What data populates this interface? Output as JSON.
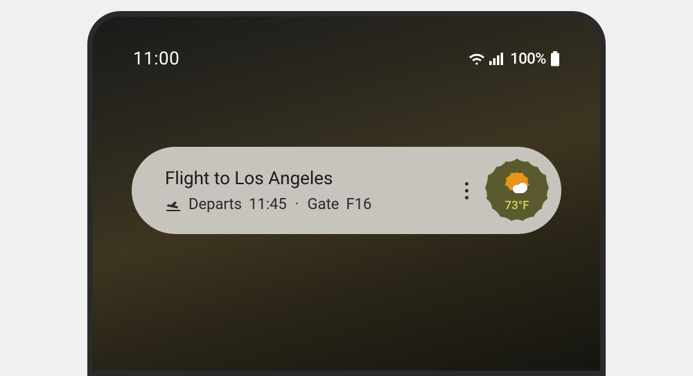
{
  "status": {
    "time": "11:00",
    "battery_percent": "100%"
  },
  "card": {
    "title": "Flight to Los Angeles",
    "departs_label": "Departs",
    "departs_time": "11:45",
    "gate_label": "Gate",
    "gate_value": "F16"
  },
  "weather": {
    "temperature": "73°F"
  }
}
